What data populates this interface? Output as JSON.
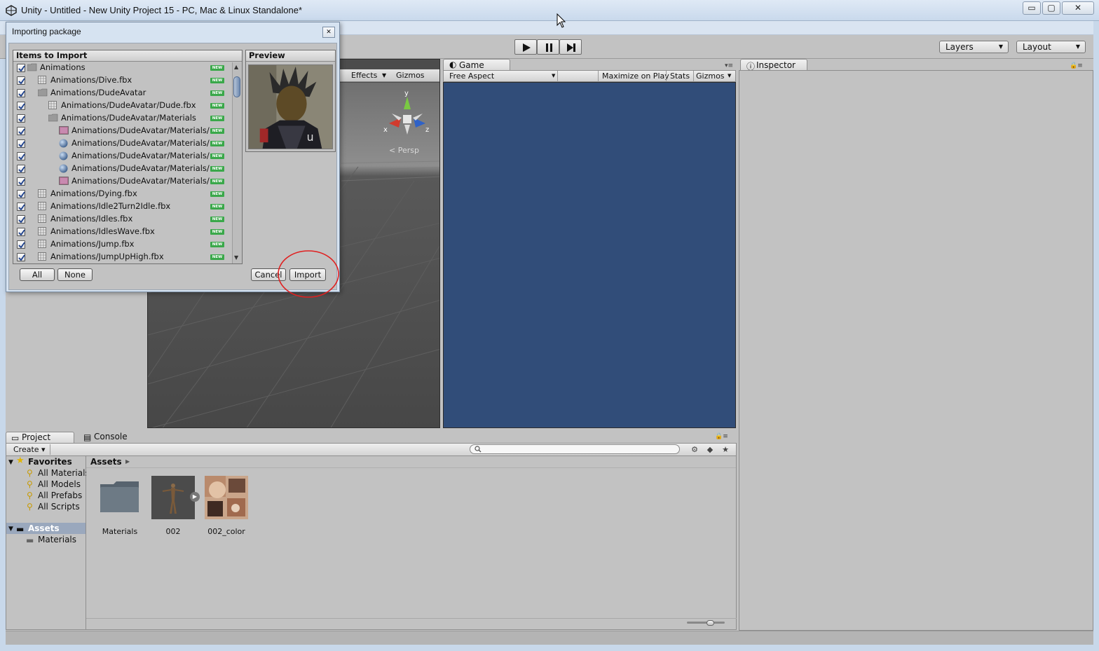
{
  "window": {
    "title": "Unity - Untitled - New Unity Project 15 - PC, Mac & Linux Standalone*",
    "min_label": "▭",
    "max_label": "▢",
    "close_label": "✕"
  },
  "toolbar": {
    "layers_label": "Layers",
    "layout_label": "Layout"
  },
  "scene": {
    "effects_label": "Effects",
    "gizmos_label": "Gizmos",
    "persp_label": "Persp",
    "axis_x": "x",
    "axis_y": "y",
    "axis_z": "z"
  },
  "game": {
    "tab_label": "Game",
    "aspect_label": "Free Aspect",
    "maximize_label": "Maximize on Play",
    "stats_label": "Stats",
    "gizmos_label": "Gizmos",
    "background_color": "#314d79"
  },
  "inspector": {
    "tab_label": "Inspector"
  },
  "project": {
    "project_tab": "Project",
    "console_tab": "Console",
    "create_label": "Create",
    "favorites_label": "Favorites",
    "favorites": [
      "All Materials",
      "All Models",
      "All Prefabs",
      "All Scripts"
    ],
    "assets_label": "Assets",
    "assets_children": [
      "Materials"
    ],
    "breadcrumb": "Assets",
    "assets": [
      {
        "label": "Materials",
        "icon": "folder-icon"
      },
      {
        "label": "002",
        "icon": "model-icon"
      },
      {
        "label": "002_color",
        "icon": "texture-icon"
      }
    ]
  },
  "dialog": {
    "title": "Importing package",
    "items_header": "Items to Import",
    "preview_header": "Preview",
    "new_badge": "NEW",
    "items": [
      {
        "label": "Animations",
        "icon": "folder-icon"
      },
      {
        "label": "Animations/Dive.fbx",
        "icon": "mesh-icon"
      },
      {
        "label": "Animations/DudeAvatar",
        "icon": "folder-icon"
      },
      {
        "label": "Animations/DudeAvatar/Dude.fbx",
        "icon": "mesh-icon"
      },
      {
        "label": "Animations/DudeAvatar/Materials",
        "icon": "folder-icon"
      },
      {
        "label": "Animations/DudeAvatar/Materials/",
        "icon": "texture-icon"
      },
      {
        "label": "Animations/DudeAvatar/Materials/",
        "icon": "material-icon"
      },
      {
        "label": "Animations/DudeAvatar/Materials/",
        "icon": "material-icon"
      },
      {
        "label": "Animations/DudeAvatar/Materials/",
        "icon": "material-icon"
      },
      {
        "label": "Animations/DudeAvatar/Materials/",
        "icon": "texture-icon"
      },
      {
        "label": "Animations/Dying.fbx",
        "icon": "mesh-icon"
      },
      {
        "label": "Animations/Idle2Turn2Idle.fbx",
        "icon": "mesh-icon"
      },
      {
        "label": "Animations/Idles.fbx",
        "icon": "mesh-icon"
      },
      {
        "label": "Animations/IdlesWave.fbx",
        "icon": "mesh-icon"
      },
      {
        "label": "Animations/Jump.fbx",
        "icon": "mesh-icon"
      },
      {
        "label": "Animations/JumpUpHigh.fbx",
        "icon": "mesh-icon"
      }
    ],
    "all_label": "All",
    "none_label": "None",
    "cancel_label": "Cancel",
    "import_label": "Import",
    "annotation_color": "#e02020"
  }
}
